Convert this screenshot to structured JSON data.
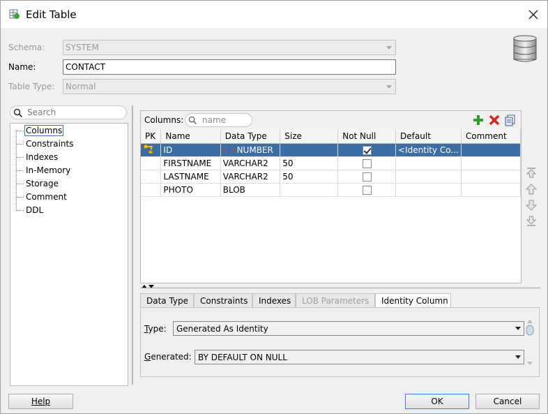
{
  "window": {
    "title": "Edit Table"
  },
  "form": {
    "schema_label": "Schema:",
    "schema_value": "SYSTEM",
    "name_label": "Name:",
    "name_value": "CONTACT",
    "table_type_label": "Table Type:",
    "table_type_value": "Normal"
  },
  "nav": {
    "search_placeholder": "Search",
    "items": [
      "Columns",
      "Constraints",
      "Indexes",
      "In-Memory",
      "Storage",
      "Comment",
      "DDL"
    ],
    "selected": "Columns"
  },
  "columns": {
    "label": "Columns:",
    "filter_placeholder": "name",
    "headers": [
      "PK",
      "Name",
      "Data Type",
      "Size",
      "Not Null",
      "Default",
      "Comment"
    ],
    "rows": [
      {
        "pk": true,
        "name": "ID",
        "type": "NUMBER",
        "size": "",
        "not_null": true,
        "default": "<Identity Co...",
        "comment": "",
        "selected": true
      },
      {
        "pk": false,
        "name": "FIRSTNAME",
        "type": "VARCHAR2",
        "size": "50",
        "not_null": false,
        "default": "",
        "comment": ""
      },
      {
        "pk": false,
        "name": "LASTNAME",
        "type": "VARCHAR2",
        "size": "50",
        "not_null": false,
        "default": "",
        "comment": ""
      },
      {
        "pk": false,
        "name": "PHOTO",
        "type": "BLOB",
        "size": "",
        "not_null": false,
        "default": "",
        "comment": ""
      }
    ]
  },
  "detail_tabs": [
    "Data Type",
    "Constraints",
    "Indexes",
    "LOB Parameters",
    "Identity Column"
  ],
  "identity": {
    "type_label": "Type:",
    "type_value": "Generated As Identity",
    "generated_label": "Generated:",
    "generated_value": "BY DEFAULT ON NULL"
  },
  "buttons": {
    "help": "Help",
    "ok": "OK",
    "cancel": "Cancel"
  },
  "colors": {
    "selection": "#3a6ea5",
    "add_icon": "#2e9e2e",
    "delete_icon": "#d8261c"
  }
}
